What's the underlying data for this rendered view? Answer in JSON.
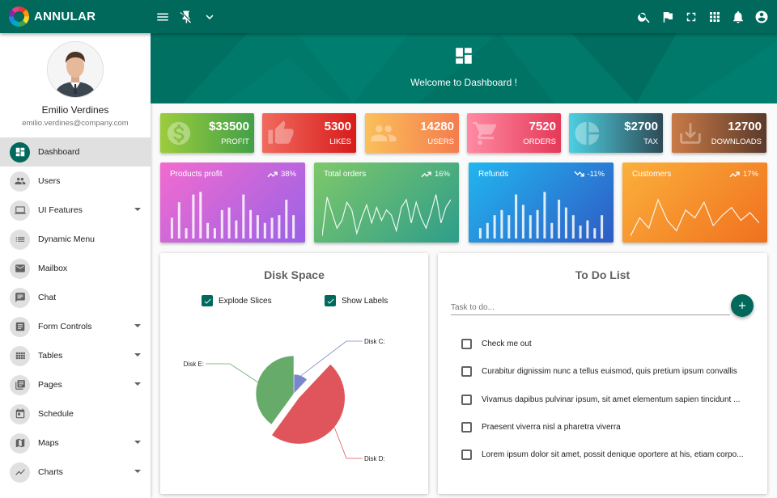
{
  "app": {
    "name": "ANNULAR"
  },
  "colors": {
    "primary": "#00695c",
    "banner": "#00796b"
  },
  "topbar": {
    "left_icons": [
      "menu-icon",
      "pin-off-icon",
      "chevron-down-icon"
    ],
    "right_icons": [
      "search-icon",
      "flag-icon",
      "fullscreen-icon",
      "apps-icon",
      "bell-icon",
      "account-icon"
    ]
  },
  "profile": {
    "name": "Emilio Verdines",
    "email": "emilio.verdines@company.com"
  },
  "sidebar": {
    "items": [
      {
        "label": "Dashboard",
        "icon": "dashboard-icon",
        "active": true,
        "submenu": false
      },
      {
        "label": "Users",
        "icon": "users-icon",
        "submenu": false
      },
      {
        "label": "UI Features",
        "icon": "laptop-icon",
        "submenu": true
      },
      {
        "label": "Dynamic Menu",
        "icon": "list-icon",
        "submenu": false
      },
      {
        "label": "Mailbox",
        "icon": "mail-icon",
        "submenu": false
      },
      {
        "label": "Chat",
        "icon": "chat-icon",
        "submenu": false
      },
      {
        "label": "Form Controls",
        "icon": "form-icon",
        "submenu": true
      },
      {
        "label": "Tables",
        "icon": "table-icon",
        "submenu": true
      },
      {
        "label": "Pages",
        "icon": "pages-icon",
        "submenu": true
      },
      {
        "label": "Schedule",
        "icon": "calendar-icon",
        "submenu": false
      },
      {
        "label": "Maps",
        "icon": "map-icon",
        "submenu": true
      },
      {
        "label": "Charts",
        "icon": "chart-icon",
        "submenu": true
      }
    ]
  },
  "banner": {
    "text": "Welcome to Dashboard !",
    "icon": "dashboard-icon"
  },
  "stats": [
    {
      "value": "$33500",
      "label": "PROFIT",
      "icon": "money-icon",
      "colors": [
        "#9ccc3d",
        "#43a047"
      ]
    },
    {
      "value": "5300",
      "label": "LIKES",
      "icon": "thumb-up-icon",
      "colors": [
        "#f06a5e",
        "#d81b1b"
      ]
    },
    {
      "value": "14280",
      "label": "USERS",
      "icon": "group-icon",
      "colors": [
        "#fbc05a",
        "#f57c4e"
      ]
    },
    {
      "value": "7520",
      "label": "ORDERS",
      "icon": "cart-icon",
      "colors": [
        "#ff8aa3",
        "#e53958"
      ]
    },
    {
      "value": "$2700",
      "label": "TAX",
      "icon": "pie-icon",
      "colors": [
        "#4dd0e1",
        "#2e4a56"
      ]
    },
    {
      "value": "12700",
      "label": "DOWNLOADS",
      "icon": "download-icon",
      "colors": [
        "#c97a47",
        "#5b3a2a"
      ]
    }
  ],
  "sparks": [
    {
      "title": "Products profit",
      "pct": "38%",
      "trend": "up",
      "type": "bar",
      "colors": [
        "#f26bd0",
        "#9a62e6"
      ],
      "values": [
        40,
        70,
        20,
        85,
        90,
        30,
        20,
        55,
        60,
        35,
        85,
        55,
        45,
        30,
        40,
        45,
        75,
        45
      ]
    },
    {
      "title": "Total orders",
      "pct": "16%",
      "trend": "up",
      "type": "line",
      "colors": [
        "#7ec86a",
        "#2e9d8a"
      ],
      "values": [
        5,
        80,
        50,
        20,
        35,
        70,
        55,
        10,
        40,
        65,
        30,
        60,
        35,
        55,
        45,
        15,
        60,
        75,
        30,
        70,
        40,
        20,
        50,
        85,
        30,
        60,
        75
      ]
    },
    {
      "title": "Refunds",
      "pct": "-11%",
      "trend": "down",
      "type": "bar",
      "colors": [
        "#21b6f0",
        "#2f5bc4"
      ],
      "values": [
        20,
        30,
        45,
        55,
        45,
        85,
        65,
        45,
        55,
        90,
        30,
        75,
        60,
        45,
        25,
        35,
        20,
        45
      ]
    },
    {
      "title": "Customers",
      "pct": "17%",
      "trend": "up",
      "type": "line",
      "colors": [
        "#fbb03b",
        "#f0701f"
      ],
      "values": [
        5,
        40,
        20,
        75,
        35,
        15,
        55,
        40,
        70,
        25,
        45,
        60,
        35,
        50,
        30
      ]
    }
  ],
  "disk": {
    "title": "Disk Space",
    "options": [
      {
        "label": "Explode Slices",
        "checked": true
      },
      {
        "label": "Show Labels",
        "checked": true
      }
    ]
  },
  "chart_data": {
    "type": "pie",
    "title": "Disk Space",
    "slices": [
      {
        "label": "Disk C:",
        "value": 12,
        "color": "#7986cb"
      },
      {
        "label": "Disk D:",
        "value": 48,
        "color": "#e0555b"
      },
      {
        "label": "Disk E:",
        "value": 40,
        "color": "#66ab6a"
      }
    ],
    "explode": true,
    "show_labels": true
  },
  "todo": {
    "title": "To Do List",
    "placeholder": "Task to do...",
    "add_icon": "plus-icon",
    "items": [
      {
        "text": "Check me out",
        "checked": false
      },
      {
        "text": "Curabitur dignissim nunc a tellus euismod, quis pretium ipsum convallis",
        "checked": false
      },
      {
        "text": "Vivamus dapibus pulvinar ipsum, sit amet elementum sapien tincidunt ...",
        "checked": false
      },
      {
        "text": "Praesent viverra nisl a pharetra viverra",
        "checked": false
      },
      {
        "text": "Lorem ipsum dolor sit amet, possit denique oportere at his, etiam corpo...",
        "checked": false
      }
    ]
  }
}
